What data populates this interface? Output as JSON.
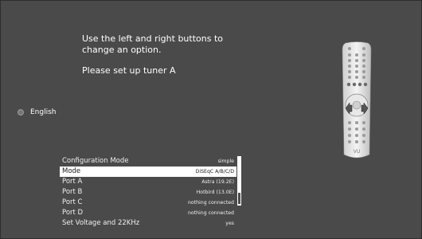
{
  "instructions": {
    "line1": "Use the left and right buttons to",
    "line2": "change an option.",
    "line3": "Please set up tuner A"
  },
  "language": {
    "label": "English"
  },
  "menu": {
    "rows": [
      {
        "label": "Configuration Mode",
        "value": "simple",
        "selected": false
      },
      {
        "label": "Mode",
        "value": "DiSEqC A/B/C/D",
        "selected": true
      },
      {
        "label": "Port A",
        "value": "Astra (19.2E)",
        "selected": false
      },
      {
        "label": "Port B",
        "value": "Hotbird (13.0E)",
        "selected": false
      },
      {
        "label": "Port C",
        "value": "nothing connected",
        "selected": false
      },
      {
        "label": "Port D",
        "value": "nothing connected",
        "selected": false
      },
      {
        "label": "Set Voltage and 22KHz",
        "value": "yes",
        "selected": false
      }
    ]
  },
  "remote": {
    "logo": "VU"
  }
}
